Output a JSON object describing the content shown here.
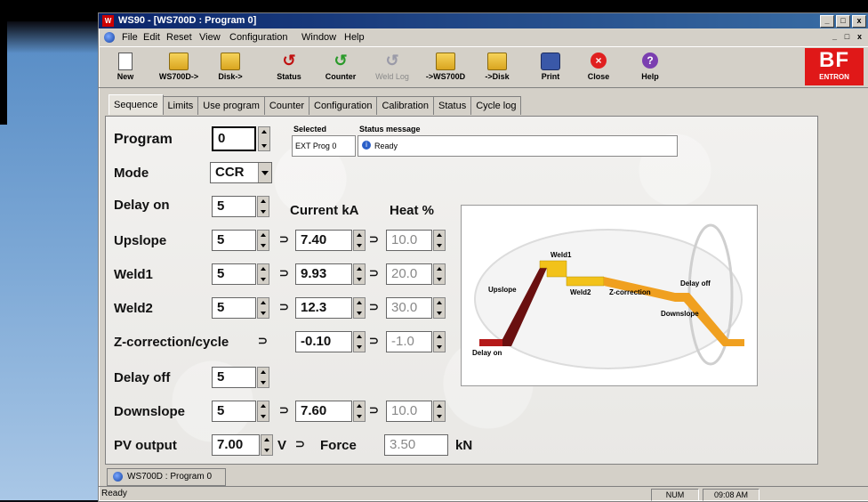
{
  "window": {
    "title": "WS90 - [WS700D : Program 0]",
    "controls": [
      "_",
      "□",
      "x"
    ]
  },
  "menu": [
    "File",
    "Edit",
    "Reset",
    "View",
    "Configuration",
    "Window",
    "Help"
  ],
  "toolbar": [
    {
      "label": "New",
      "icon": "new-document-icon",
      "enabled": true
    },
    {
      "label": "WS700D->",
      "icon": "folder-open-icon",
      "enabled": true
    },
    {
      "label": "Disk->",
      "icon": "folder-open-icon",
      "enabled": true
    },
    {
      "label": "Status",
      "icon": "status-icon",
      "enabled": true
    },
    {
      "label": "Counter",
      "icon": "counter-icon",
      "enabled": true
    },
    {
      "label": "Weld Log",
      "icon": "weld-log-icon",
      "enabled": false
    },
    {
      "label": "->WS700D",
      "icon": "save-to-device-icon",
      "enabled": true
    },
    {
      "label": "->Disk",
      "icon": "save-to-disk-icon",
      "enabled": true
    },
    {
      "label": "Print",
      "icon": "print-icon",
      "enabled": true
    },
    {
      "label": "Close",
      "icon": "close-icon",
      "enabled": true
    },
    {
      "label": "Help",
      "icon": "help-icon",
      "enabled": true
    }
  ],
  "logo": {
    "line1": "BF",
    "line2": "ENTRON",
    "color": "#e01818"
  },
  "tabs": [
    "Sequence",
    "Limits",
    "Use program",
    "Counter",
    "Configuration",
    "Calibration",
    "Status",
    "Cycle log"
  ],
  "active_tab": "Sequence",
  "status": {
    "selected_header": "Selected",
    "status_header": "Status message",
    "selected_value": "EXT Prog 0",
    "status_value": "Ready"
  },
  "form": {
    "program_label": "Program",
    "program_value": "0",
    "mode_label": "Mode",
    "mode_value": "CCR",
    "delay_on_label": "Delay on",
    "delay_on_value": "5",
    "current_header": "Current kA",
    "heat_header": "Heat %",
    "upslope_label": "Upslope",
    "upslope_value": "5",
    "upslope_current": "7.40",
    "upslope_heat": "10.0",
    "weld1_label": "Weld1",
    "weld1_value": "5",
    "weld1_current": "9.93",
    "weld1_heat": "20.0",
    "weld2_label": "Weld2",
    "weld2_value": "5",
    "weld2_current": "12.3",
    "weld2_heat": "30.0",
    "zcorr_label": "Z-correction/cycle",
    "zcorr_current": "-0.10",
    "zcorr_heat": "-1.0",
    "delay_off_label": "Delay off",
    "delay_off_value": "5",
    "downslope_label": "Downslope",
    "downslope_value": "5",
    "downslope_current": "7.60",
    "downslope_heat": "10.0",
    "pv_label": "PV output",
    "pv_value": "7.00",
    "pv_unit": "V",
    "force_label": "Force",
    "force_value": "3.50",
    "force_unit": "kN"
  },
  "diagram": {
    "labels": [
      "Delay on",
      "Upslope",
      "Weld1",
      "Weld2",
      "Z-correction",
      "Delay off",
      "Downslope"
    ],
    "colors": {
      "delay_on": "#b51a1a",
      "upslope": "#6a1010",
      "weld": "#f2c21a",
      "zcorr": "#f0a020"
    }
  },
  "bottom_tab": "WS700D : Program 0",
  "statusbar": {
    "text": "Ready",
    "num": "NUM",
    "time": "09:08 AM"
  }
}
